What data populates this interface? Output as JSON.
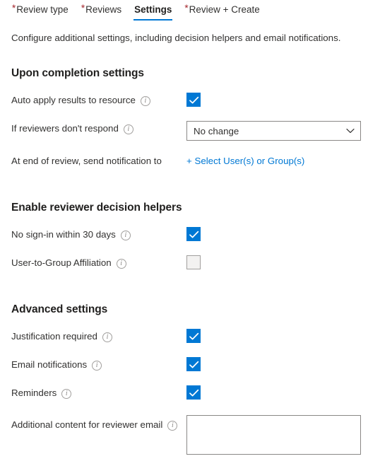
{
  "tabs": [
    {
      "label": "Review type",
      "required": true,
      "active": false
    },
    {
      "label": "Reviews",
      "required": true,
      "active": false
    },
    {
      "label": "Settings",
      "required": false,
      "active": true
    },
    {
      "label": "Review + Create",
      "required": true,
      "active": false
    }
  ],
  "intro": "Configure additional settings, including decision helpers and email notifications.",
  "sections": [
    {
      "heading": "Upon completion settings",
      "rows": [
        {
          "label": "Auto apply results to resource",
          "control": "checkbox",
          "checked": true,
          "info": true
        },
        {
          "label": "If reviewers don't respond",
          "control": "dropdown",
          "value": "No change",
          "info": true
        },
        {
          "label": "At end of review, send notification to",
          "control": "link",
          "value": "+ Select User(s) or Group(s)",
          "info": false
        }
      ]
    },
    {
      "heading": "Enable reviewer decision helpers",
      "rows": [
        {
          "label": "No sign-in within 30 days",
          "control": "checkbox",
          "checked": true,
          "info": true
        },
        {
          "label": "User-to-Group Affiliation",
          "control": "checkbox",
          "checked": false,
          "info": true
        }
      ]
    },
    {
      "heading": "Advanced settings",
      "rows": [
        {
          "label": "Justification required",
          "control": "checkbox",
          "checked": true,
          "info": true
        },
        {
          "label": "Email notifications",
          "control": "checkbox",
          "checked": true,
          "info": true
        },
        {
          "label": "Reminders",
          "control": "checkbox",
          "checked": true,
          "info": true
        },
        {
          "label": "Additional content for reviewer email",
          "control": "textarea",
          "value": "",
          "info": true
        }
      ]
    }
  ],
  "icons": {
    "info": "info-icon",
    "chevron_down": "chevron-down-icon",
    "check": "check-icon"
  },
  "colors": {
    "accent": "#0078d4",
    "required_asterisk": "#a4262c",
    "text": "#323130",
    "border": "#8a8886",
    "disabled_fill": "#f3f2f1"
  }
}
